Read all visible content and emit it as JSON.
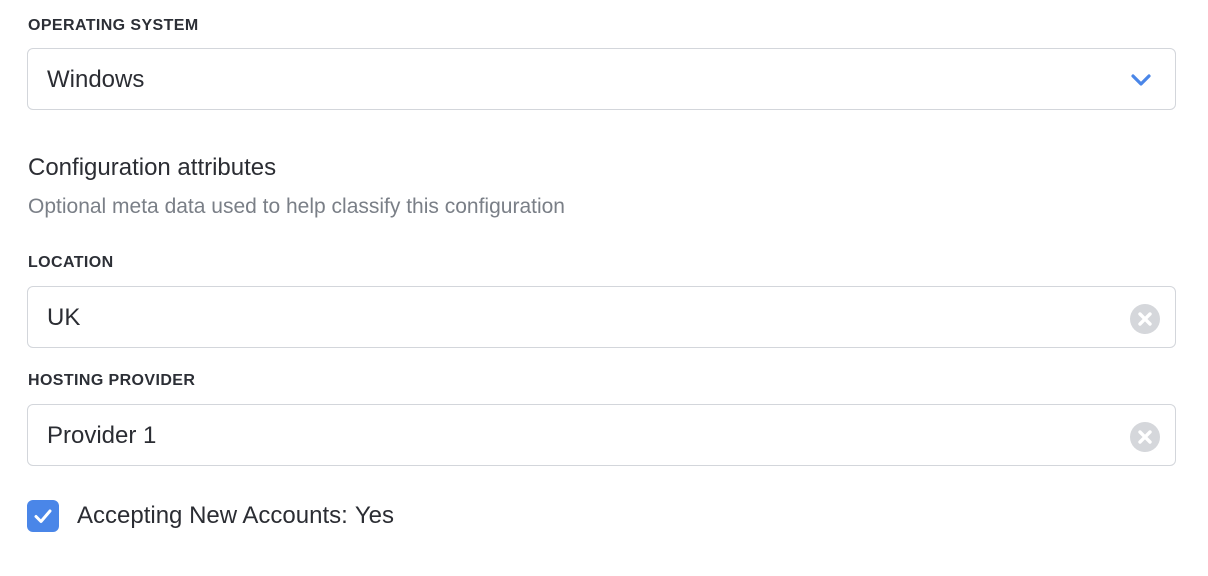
{
  "operating_system": {
    "label": "OPERATING SYSTEM",
    "selected": "Windows",
    "icon": "chevron-down-icon",
    "icon_color": "#4a86e8"
  },
  "configuration_attributes": {
    "title": "Configuration attributes",
    "subtitle": "Optional meta data used to help classify this configuration"
  },
  "location": {
    "label": "LOCATION",
    "value": "UK",
    "icon": "clear-icon"
  },
  "hosting_provider": {
    "label": "HOSTING PROVIDER",
    "value": "Provider 1",
    "icon": "clear-icon"
  },
  "accepting_new_accounts": {
    "label": "Accepting New Accounts:",
    "value": "Yes",
    "checked": true,
    "accent_color": "#4a86e8"
  },
  "colors": {
    "border": "#d3d6db",
    "text": "#2b2d33",
    "muted_text": "#7a7f87",
    "clear_icon": "#d5d7db"
  }
}
